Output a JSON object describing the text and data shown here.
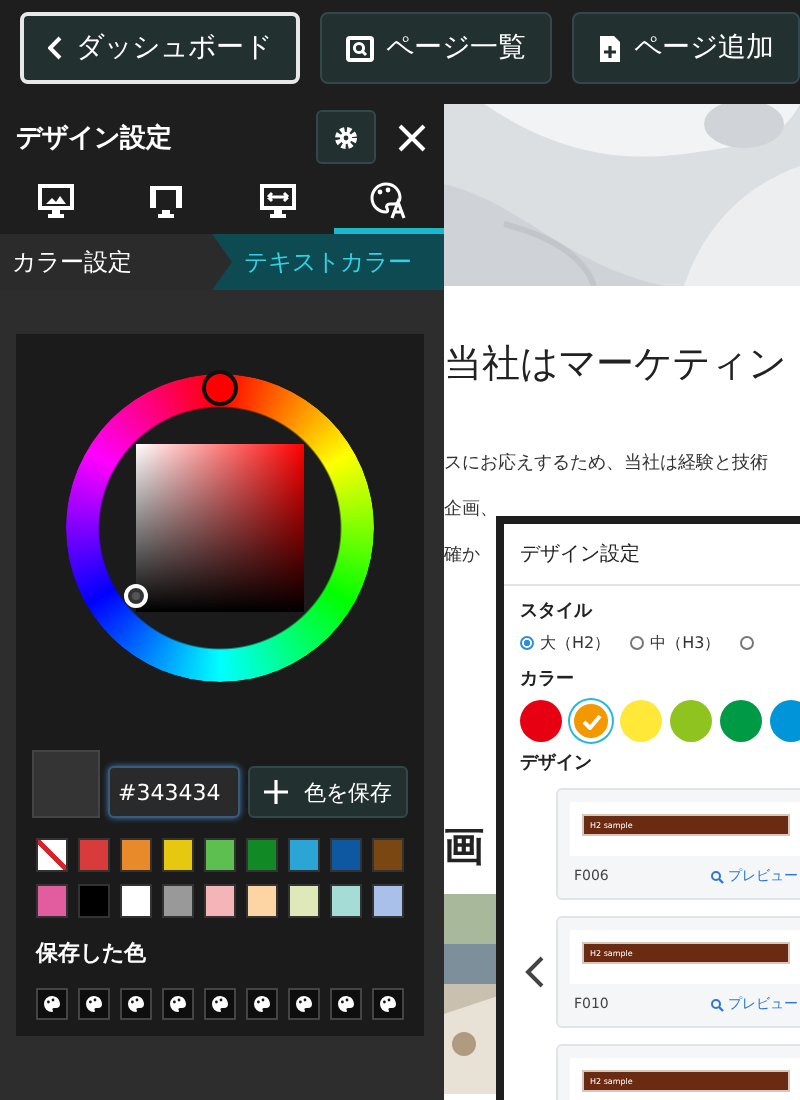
{
  "toolbar": {
    "buttons": [
      {
        "label": "ダッシュボード",
        "selected": true
      },
      {
        "label": "ページ一覧",
        "selected": false
      },
      {
        "label": "ページ追加",
        "selected": false
      }
    ]
  },
  "panel": {
    "title": "デザイン設定",
    "tabs": [
      {
        "selected": false
      },
      {
        "selected": false
      },
      {
        "selected": false
      },
      {
        "selected": true
      }
    ],
    "steps": [
      {
        "label": "カラー設定",
        "selected": false
      },
      {
        "label": "テキストカラー",
        "selected": true
      }
    ],
    "picker": {
      "hex_value": "#343434",
      "save_button": "色を保存",
      "swatches": [
        {
          "kind": "none"
        },
        {
          "kind": "color",
          "color": "#d93a3a"
        },
        {
          "kind": "color",
          "color": "#e8892a"
        },
        {
          "kind": "color",
          "color": "#e6c810"
        },
        {
          "kind": "color",
          "color": "#5cbf50"
        },
        {
          "kind": "color",
          "color": "#118a25"
        },
        {
          "kind": "color",
          "color": "#2aa5d6"
        },
        {
          "kind": "color",
          "color": "#0d58a0"
        },
        {
          "kind": "color",
          "color": "#7a4712"
        },
        {
          "kind": "color",
          "color": "#e25ca0"
        },
        {
          "kind": "color",
          "color": "#000000"
        },
        {
          "kind": "color",
          "color": "#ffffff"
        },
        {
          "kind": "color",
          "color": "#999999"
        },
        {
          "kind": "color",
          "color": "#f4b4b8"
        },
        {
          "kind": "color",
          "color": "#fdd5a5"
        },
        {
          "kind": "color",
          "color": "#dfe8b8"
        },
        {
          "kind": "color",
          "color": "#a5dcd5"
        },
        {
          "kind": "color",
          "color": "#a8c0ea"
        }
      ],
      "saved_title": "保存した色",
      "saved_slots": [
        {
          "kind": "empty"
        },
        {
          "kind": "empty"
        },
        {
          "kind": "empty"
        },
        {
          "kind": "empty"
        },
        {
          "kind": "empty"
        },
        {
          "kind": "empty"
        },
        {
          "kind": "empty"
        },
        {
          "kind": "empty"
        },
        {
          "kind": "empty"
        }
      ]
    }
  },
  "page": {
    "heading": "当社はマーケティン",
    "lines": [
      "スにお応えするため、当社は経験と技術",
      "企画、",
      "確か"
    ],
    "subheading": "画"
  },
  "dialog": {
    "title": "デザイン設定",
    "style_label": "スタイル",
    "styles": [
      {
        "label": "大（H2）",
        "selected": true
      },
      {
        "label": "中（H3）",
        "selected": false
      },
      {
        "selected": false
      }
    ],
    "color_label": "カラー",
    "colors": [
      {
        "color": "#e60012",
        "selected": false
      },
      {
        "color": "#f39800",
        "selected": true
      },
      {
        "color": "#ffe838",
        "selected": false
      },
      {
        "color": "#8fc31f",
        "selected": false
      },
      {
        "color": "#009944",
        "selected": false
      },
      {
        "color": "#0095d9",
        "selected": false
      }
    ],
    "design_label": "デザイン",
    "designs": [
      {
        "sample": "H2 sample",
        "code": "F006",
        "preview": "プレビュー"
      },
      {
        "sample": "H2 sample",
        "code": "F010",
        "preview": "プレビュー"
      },
      {
        "sample": "H2 sample"
      }
    ]
  }
}
